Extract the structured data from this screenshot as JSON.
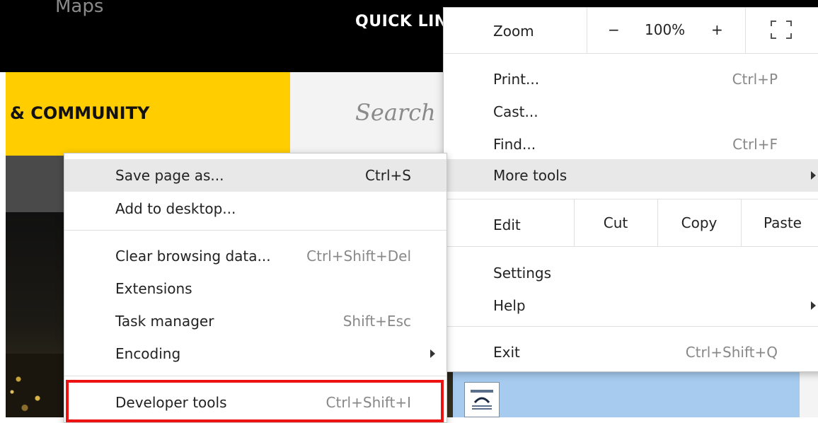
{
  "background_site": {
    "maps_label": "Maps",
    "quick_links_label": "QUICK LIN",
    "community_label": "& COMMUNITY",
    "search_placeholder": "Search T"
  },
  "menu": {
    "zoom": {
      "label": "Zoom",
      "minus": "−",
      "value": "100%",
      "plus": "+"
    },
    "print": {
      "label": "Print...",
      "shortcut": "Ctrl+P"
    },
    "cast": {
      "label": "Cast..."
    },
    "find": {
      "label": "Find...",
      "shortcut": "Ctrl+F"
    },
    "more_tools": {
      "label": "More tools"
    },
    "edit": {
      "label": "Edit",
      "cut": "Cut",
      "copy": "Copy",
      "paste": "Paste"
    },
    "settings": {
      "label": "Settings"
    },
    "help": {
      "label": "Help"
    },
    "exit": {
      "label": "Exit",
      "shortcut": "Ctrl+Shift+Q"
    }
  },
  "submenu": {
    "save_page": {
      "label": "Save page as...",
      "shortcut": "Ctrl+S"
    },
    "add_desktop": {
      "label": "Add to desktop..."
    },
    "clear_data": {
      "label": "Clear browsing data...",
      "shortcut": "Ctrl+Shift+Del"
    },
    "extensions": {
      "label": "Extensions"
    },
    "task_manager": {
      "label": "Task manager",
      "shortcut": "Shift+Esc"
    },
    "encoding": {
      "label": "Encoding"
    },
    "developer_tools": {
      "label": "Developer tools",
      "shortcut": "Ctrl+Shift+I"
    }
  },
  "colors": {
    "highlight_box": "#ee1111",
    "brand_yellow": "#ffcd00",
    "menu_hover": "#e8e8e8"
  }
}
